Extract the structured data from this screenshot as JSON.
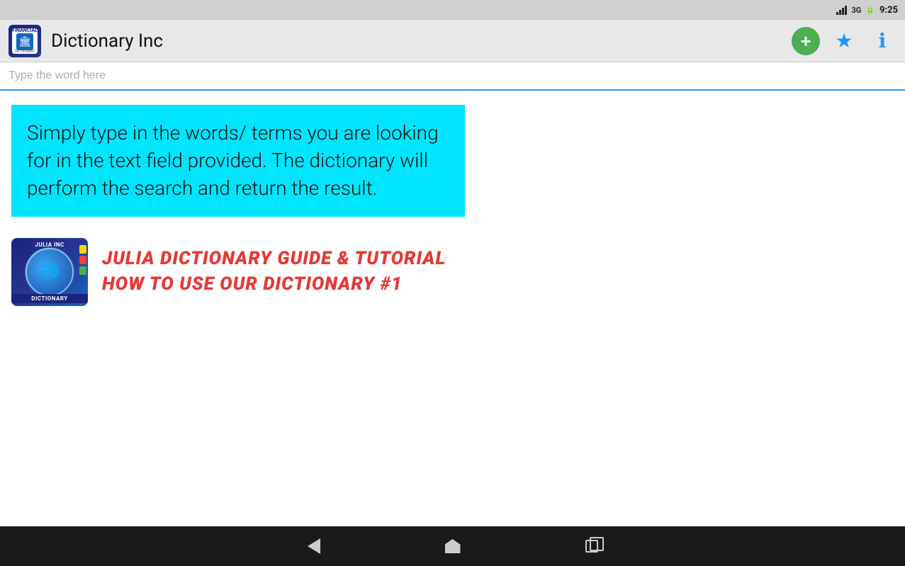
{
  "statusBar": {
    "signal": "3G",
    "time": "9:25"
  },
  "appBar": {
    "title": "Dictionary Inc",
    "iconAlt": "Financial Dictionary app icon",
    "actions": {
      "add": "+",
      "star": "★",
      "info": "ℹ"
    }
  },
  "search": {
    "placeholder": "Type the word here",
    "value": ""
  },
  "infoBox": {
    "text": "Simply type in the words/ terms you are looking for in the text field provided. The dictionary will perform the search and return the result."
  },
  "tutorialCard": {
    "line1": "JULIA DICTIONARY GUIDE & TUTORIAL",
    "line2": "HOW TO USE OUR DICTIONARY #1",
    "thumbAlt": "Julia Inc Dictionary app thumbnail"
  },
  "navBar": {
    "back": "back",
    "home": "home",
    "recent": "recent"
  }
}
